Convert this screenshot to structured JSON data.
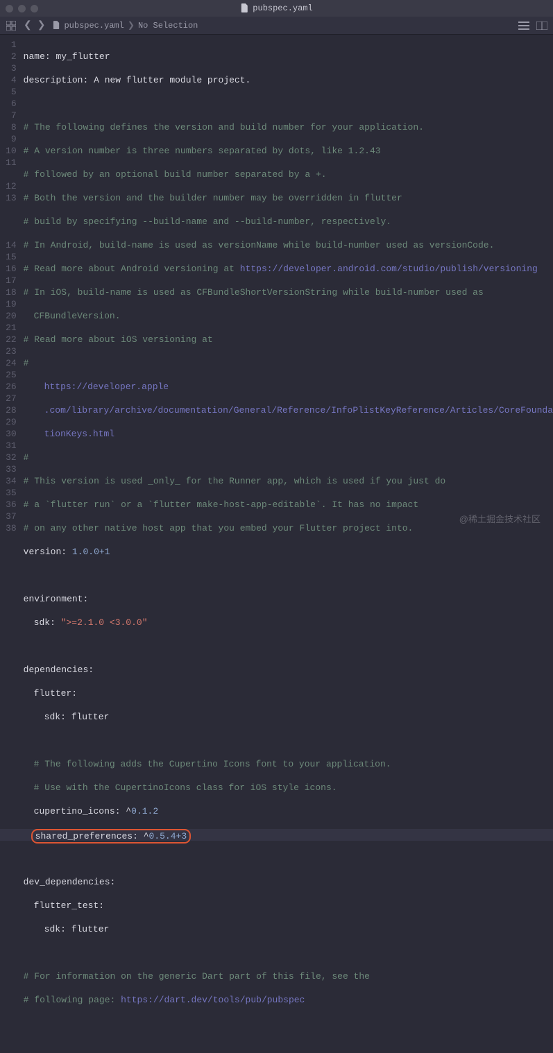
{
  "titlebar": {
    "filename": "pubspec.yaml"
  },
  "toolbar": {
    "breadcrumb_file": "pubspec.yaml",
    "breadcrumb_sel": "No Selection"
  },
  "lines": {
    "l1_key": "name:",
    "l1_val": " my_flutter",
    "l2_key": "description:",
    "l2_val": " A new flutter module project.",
    "l4": "# The following defines the version and build number for your application.",
    "l5": "# A version number is three numbers separated by dots, like 1.2.43",
    "l6": "# followed by an optional build number separated by a +.",
    "l7": "# Both the version and the builder number may be overridden in flutter",
    "l8": "# build by specifying --build-name and --build-number, respectively.",
    "l9": "# In Android, build-name is used as versionName while build-number used as versionCode.",
    "l10a": "# Read more about Android versioning at ",
    "l10b": "https://developer.android.com/studio/publish/versioning",
    "l11a": "# In iOS, build-name is used as CFBundleShortVersionString while build-number used as",
    "l11b": "CFBundleVersion.",
    "l12": "# Read more about iOS versioning at",
    "l13": "#",
    "l13b": "https://developer.apple",
    "l13c": ".com/library/archive/documentation/General/Reference/InfoPlistKeyReference/Articles/CoreFounda",
    "l13d": "tionKeys.html",
    "l14": "#",
    "l15": "# This version is used _only_ for the Runner app, which is used if you just do",
    "l16": "# a `flutter run` or a `flutter make-host-app-editable`. It has no impact",
    "l17": "# on any other native host app that you embed your Flutter project into.",
    "l18_key": "version:",
    "l18_val": " 1.0.0+1",
    "l20_key": "environment:",
    "l21_key": "sdk:",
    "l21_val": " \">=2.1.0 <3.0.0\"",
    "l23_key": "dependencies:",
    "l24_key": "flutter:",
    "l25_key": "sdk:",
    "l25_val": " flutter",
    "l27": "# The following adds the Cupertino Icons font to your application.",
    "l28": "# Use with the CupertinoIcons class for iOS style icons.",
    "l29_key": "cupertino_icons:",
    "l29_val": " ^",
    "l29_num": "0.1.2",
    "l30_key": "shared_preferences:",
    "l30_val": " ^",
    "l30_num": "0.5.4+3",
    "l32_key": "dev_dependencies:",
    "l33_key": "flutter_test:",
    "l34_key": "sdk:",
    "l34_val": " flutter",
    "l36": "# For information on the generic Dart part of this file, see the",
    "l37a": "# following page: ",
    "l37b": "https://dart.dev/tools/pub/pubspec"
  },
  "line_numbers": [
    "1",
    "2",
    "3",
    "4",
    "5",
    "6",
    "7",
    "8",
    "9",
    "10",
    "11",
    "",
    "12",
    "13",
    "",
    "",
    "",
    "14",
    "15",
    "16",
    "17",
    "18",
    "19",
    "20",
    "21",
    "22",
    "23",
    "24",
    "25",
    "26",
    "27",
    "28",
    "29",
    "30",
    "31",
    "32",
    "33",
    "34",
    "35",
    "36",
    "37",
    "38"
  ],
  "watermark": "@稀土掘金技术社区"
}
